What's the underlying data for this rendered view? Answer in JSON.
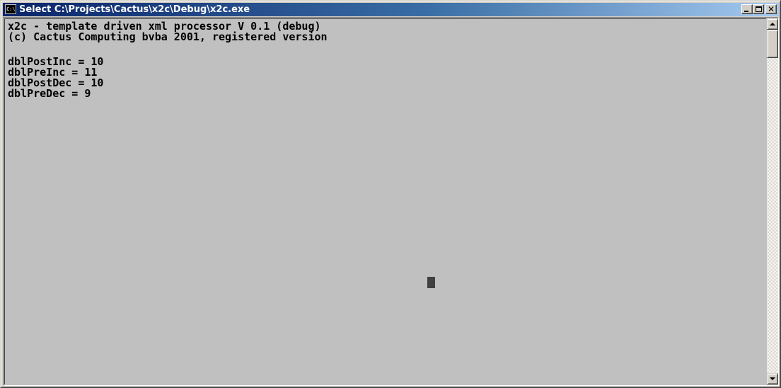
{
  "window": {
    "title": "Select C:\\Projects\\Cactus\\x2c\\Debug\\x2c.exe",
    "icon": "console-icon",
    "icon_text": "C:\\",
    "controls": {
      "minimize": "minimize-icon",
      "maximize": "maximize-icon",
      "close": "close-icon",
      "close_glyph": "✕"
    }
  },
  "console": {
    "lines": [
      "x2c - template driven xml processor V 0.1 (debug)",
      "(c) Cactus Computing bvba 2001, registered version",
      "",
      "dblPostInc = 10",
      "dblPreInc = 11",
      "dblPostDec = 10",
      "dblPreDec = 9"
    ],
    "background": "#c0c0c0",
    "foreground": "#000000"
  },
  "scrollbar": {
    "up": "scroll-up-arrow-icon",
    "down": "scroll-down-arrow-icon",
    "position": 0.0
  }
}
